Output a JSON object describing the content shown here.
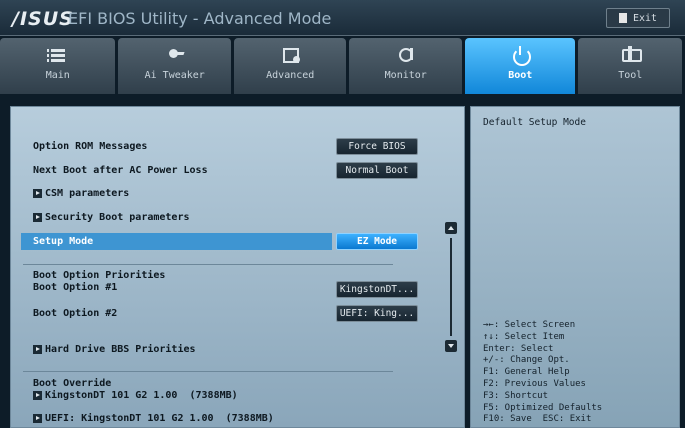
{
  "header": {
    "logo": "/ISUS",
    "title": "EFI BIOS Utility - Advanced Mode",
    "exit_label": "Exit"
  },
  "tabs": [
    {
      "label": "Main",
      "icon": "list-icon"
    },
    {
      "label": "Ai Tweaker",
      "icon": "ai-tweaker-icon"
    },
    {
      "label": "Advanced",
      "icon": "advanced-icon"
    },
    {
      "label": "Monitor",
      "icon": "monitor-icon"
    },
    {
      "label": "Boot",
      "icon": "power-icon",
      "active": true
    },
    {
      "label": "Tool",
      "icon": "tool-icon"
    }
  ],
  "settings": {
    "option_rom": {
      "label": "Option ROM Messages",
      "value": "Force BIOS"
    },
    "next_boot": {
      "label": "Next Boot after AC Power Loss",
      "value": "Normal Boot"
    },
    "csm": "CSM parameters",
    "security_boot": "Security Boot parameters",
    "setup_mode": {
      "label": "Setup Mode",
      "value": "EZ Mode"
    },
    "boot_priorities_heading": "Boot Option Priorities",
    "boot_option_1": {
      "label": "Boot Option #1",
      "value": "KingstonDT..."
    },
    "boot_option_2": {
      "label": "Boot Option #2",
      "value": "UEFI: King..."
    },
    "hdd_bbs": "Hard Drive BBS Priorities",
    "boot_override_heading": "Boot Override",
    "override_1": "KingstonDT 101 G2 1.00  (7388MB)",
    "override_2": "UEFI: KingstonDT 101 G2 1.00  (7388MB)"
  },
  "help": {
    "description": "Default Setup Mode",
    "keys": [
      "→←: Select Screen",
      "↑↓: Select Item",
      "Enter: Select",
      "+/-: Change Opt.",
      "F1: General Help",
      "F2: Previous Values",
      "F3: Shortcut",
      "F5: Optimized Defaults",
      "F10: Save  ESC: Exit"
    ]
  },
  "colors": {
    "accent": "#1a8fe3",
    "panel": "#a8c0d1",
    "background": "#0d1c28"
  }
}
